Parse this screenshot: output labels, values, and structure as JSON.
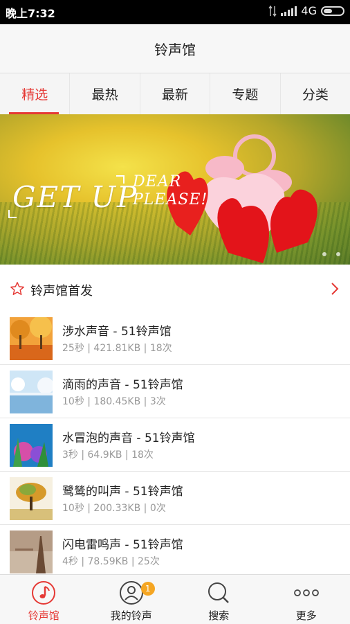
{
  "status": {
    "time": "晚上7:32",
    "network": "4G"
  },
  "title": "铃声馆",
  "tabs": [
    {
      "label": "精选",
      "active": true
    },
    {
      "label": "最热"
    },
    {
      "label": "最新"
    },
    {
      "label": "专题"
    },
    {
      "label": "分类"
    }
  ],
  "banner": {
    "headline": "GET UP",
    "line1": "DEAR",
    "line2": "PLEASE!",
    "pages": 2,
    "current_page": 1
  },
  "section": {
    "title": "铃声馆首发"
  },
  "items": [
    {
      "name": "涉水声音 - 51铃声馆",
      "meta": "25秒 | 421.81KB | 18次",
      "thumb": "autumn-trees"
    },
    {
      "name": "滴雨的声音 - 51铃声馆",
      "meta": "10秒 | 180.45KB | 3次",
      "thumb": "winter-lake"
    },
    {
      "name": "水冒泡的声音 - 51铃声馆",
      "meta": "3秒 | 64.9KB | 18次",
      "thumb": "coral-reef"
    },
    {
      "name": "鹭鸶的叫声 - 51铃声馆",
      "meta": "10秒 | 200.33KB | 0次",
      "thumb": "lone-tree"
    },
    {
      "name": "闪电雷鸣声 - 51铃声馆",
      "meta": "4秒 | 78.59KB | 25次",
      "thumb": "eiffel-tower"
    }
  ],
  "bottom_nav": [
    {
      "label": "铃声馆",
      "icon": "music-note-icon",
      "active": true
    },
    {
      "label": "我的铃声",
      "icon": "user-icon",
      "badge": "1"
    },
    {
      "label": "搜索",
      "icon": "search-icon"
    },
    {
      "label": "更多",
      "icon": "more-icon"
    }
  ],
  "colors": {
    "accent": "#e53935",
    "badge": "#f5a623"
  }
}
